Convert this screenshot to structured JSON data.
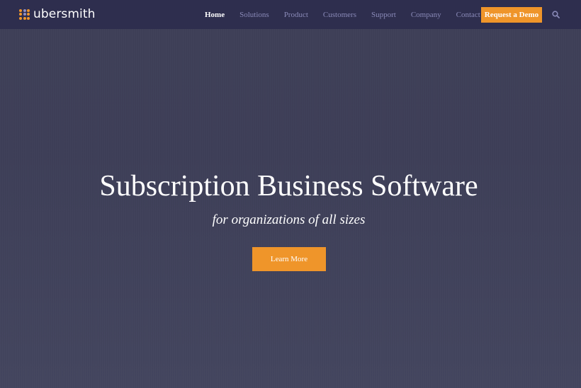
{
  "brand": {
    "name": "ubersmith",
    "logo_icon": "dot-grid-logo-icon",
    "colors": {
      "accent": "#ef952a",
      "nav_bg": "#2e2e4e",
      "hero_bg": "#3f4058",
      "nav_link": "#8a8ab8",
      "logo_secondary": "#8f8fc6"
    }
  },
  "nav": {
    "items": [
      {
        "label": "Home",
        "active": true
      },
      {
        "label": "Solutions",
        "active": false
      },
      {
        "label": "Product",
        "active": false
      },
      {
        "label": "Customers",
        "active": false
      },
      {
        "label": "Support",
        "active": false
      },
      {
        "label": "Company",
        "active": false
      },
      {
        "label": "Contact",
        "active": false
      }
    ],
    "cta_label": "Request a Demo",
    "search_icon": "search-icon"
  },
  "hero": {
    "title": "Subscription Business Software",
    "subtitle": "for organizations of all sizes",
    "button_label": "Learn More"
  }
}
